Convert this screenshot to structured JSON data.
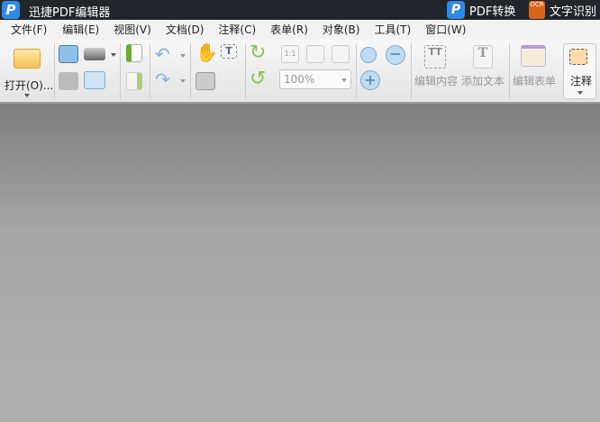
{
  "titlebar": {
    "app_title": "迅捷PDF编辑器",
    "pdf_convert": "PDF转换",
    "ocr": "文字识别",
    "ocr_badge": "OCR",
    "logo": "P"
  },
  "menu": [
    "文件(F)",
    "编辑(E)",
    "视图(V)",
    "文档(D)",
    "注释(C)",
    "表单(R)",
    "对象(B)",
    "工具(T)",
    "窗口(W)"
  ],
  "toolbar": {
    "open": "打开(O)...",
    "zoom_value": "100%",
    "actual_size": "1:1",
    "edit_content": "编辑内容",
    "add_text": "添加文本",
    "edit_form": "编辑表单",
    "annotate": "注释"
  }
}
